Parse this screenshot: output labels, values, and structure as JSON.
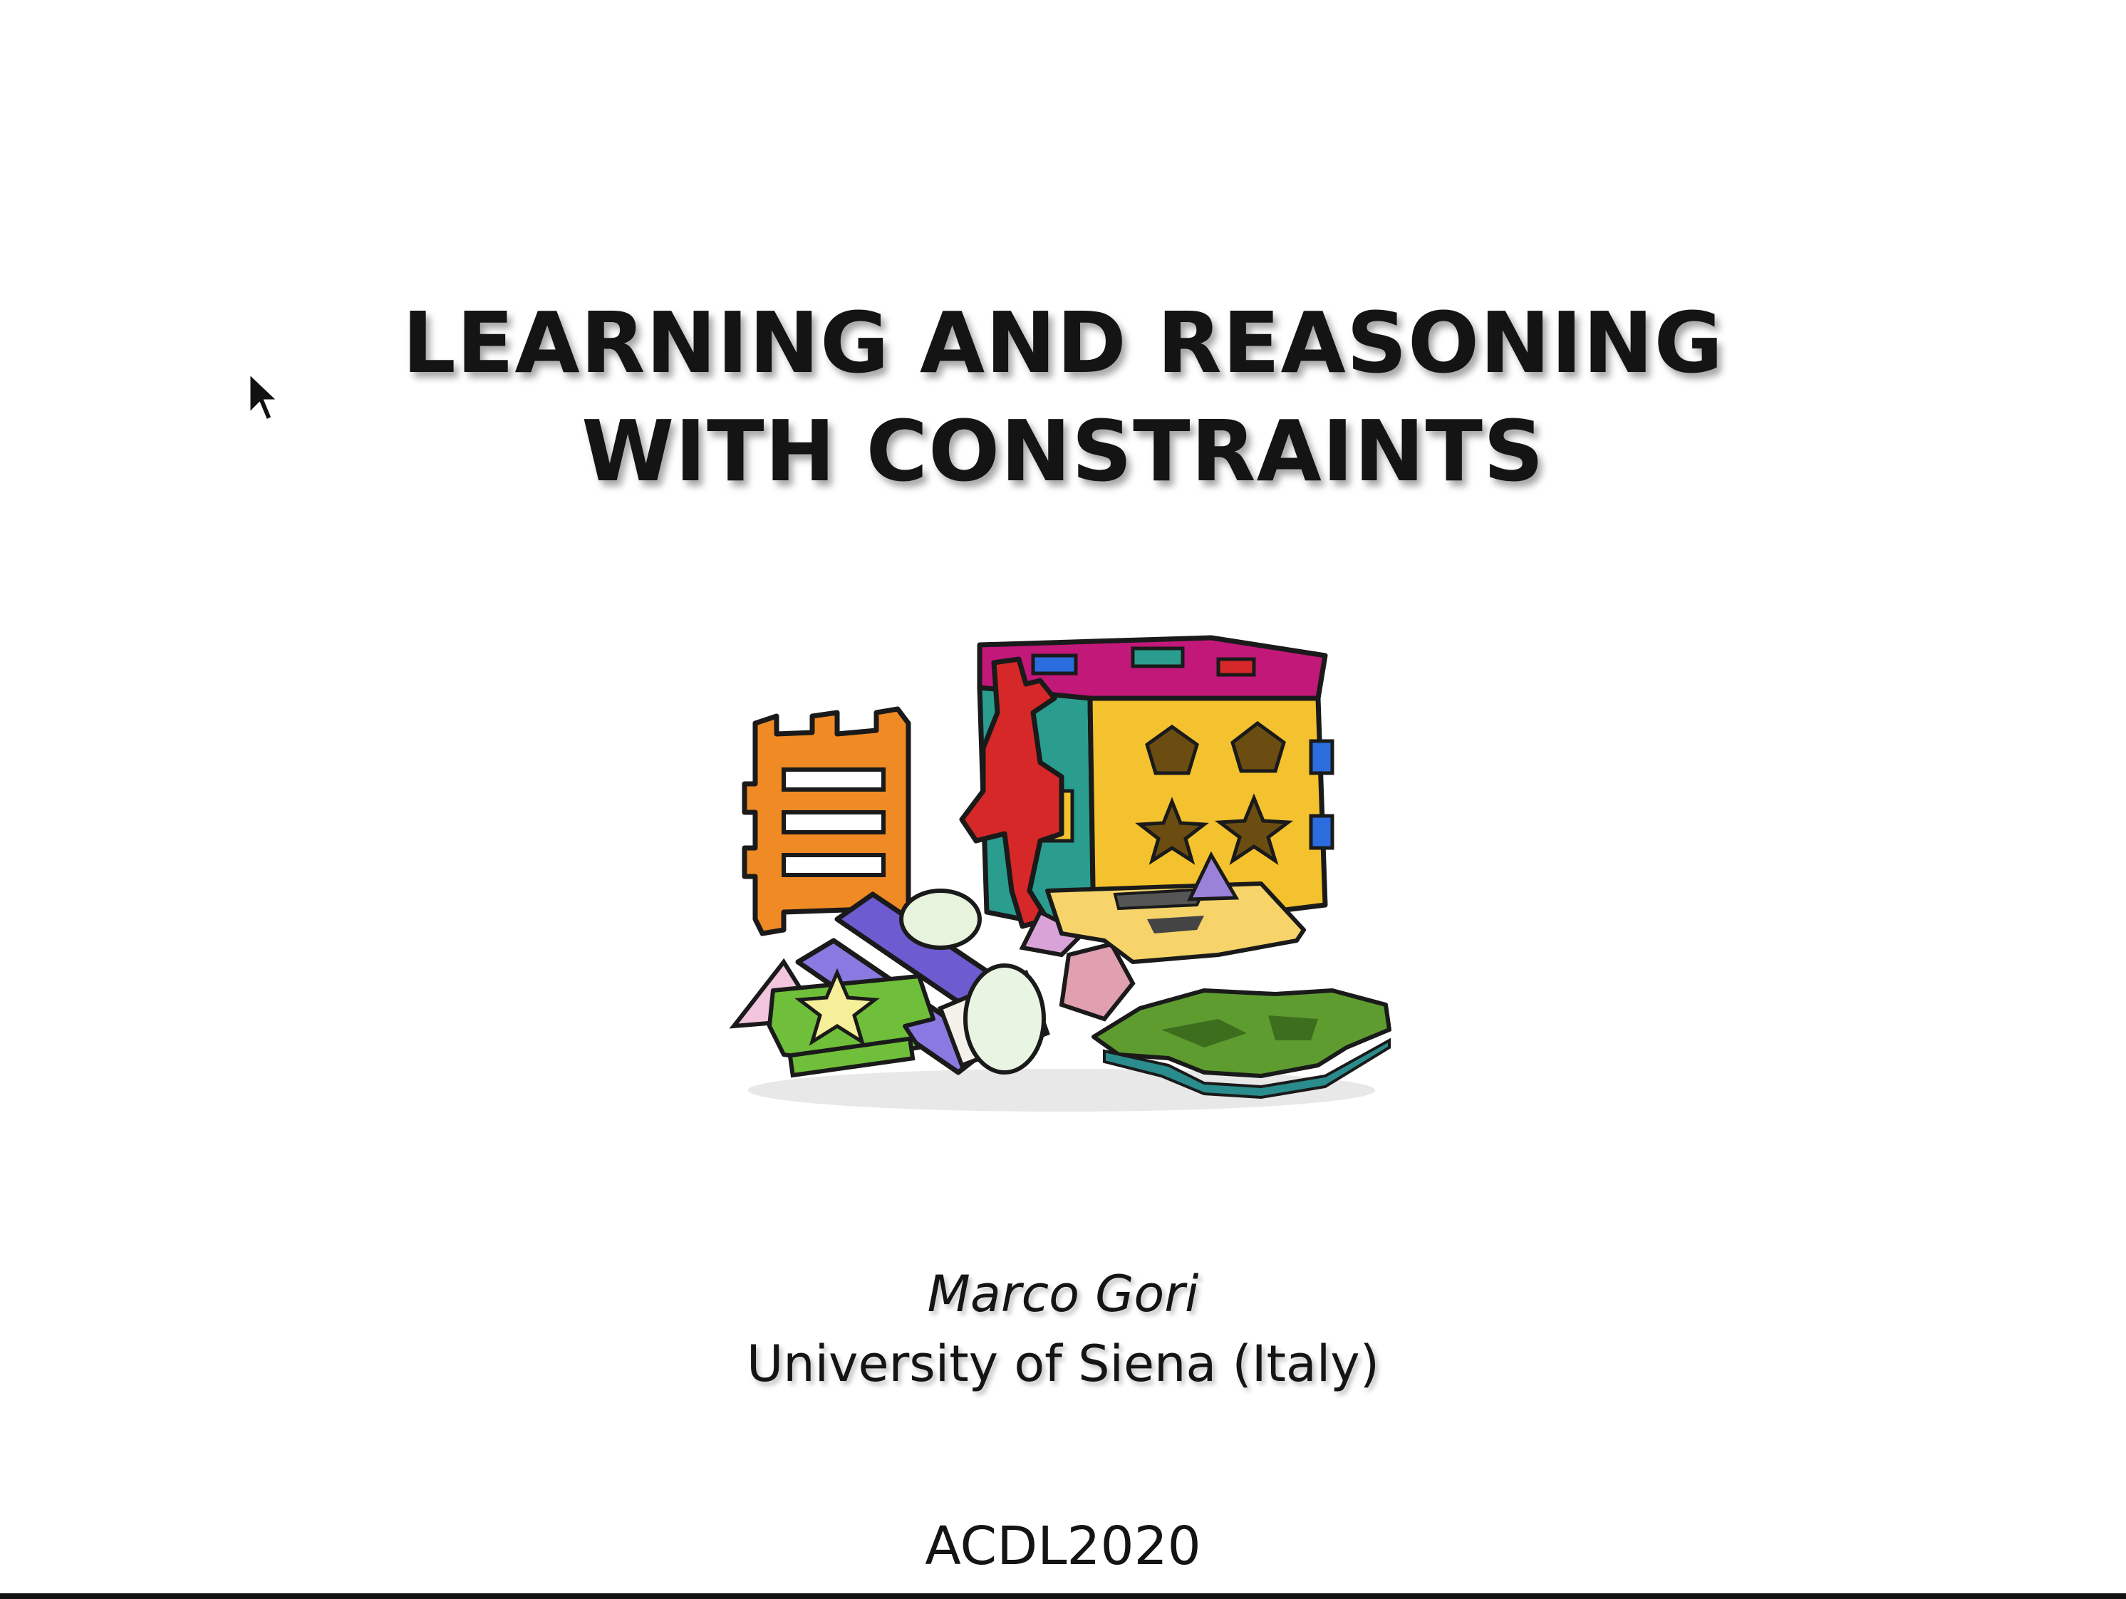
{
  "slide": {
    "title_lines": [
      "LEARNING AND REASONING",
      "WITH CONSTRAINTS"
    ],
    "author": "Marco Gori",
    "affiliation": "University of Siena (Italy)",
    "event": "ACDL2020"
  },
  "illustration": {
    "icon": "toy-shapes-clipart-icon",
    "colors": {
      "orange": "#f08a24",
      "yellow": "#f3c22e",
      "magenta": "#c2187a",
      "teal": "#2a9d8f",
      "green": "#6fbf3a",
      "purple": "#6d5bd0",
      "red": "#d62828",
      "blue": "#2b6cdf"
    }
  },
  "pointer": {
    "icon": "mouse-pointer-icon"
  }
}
